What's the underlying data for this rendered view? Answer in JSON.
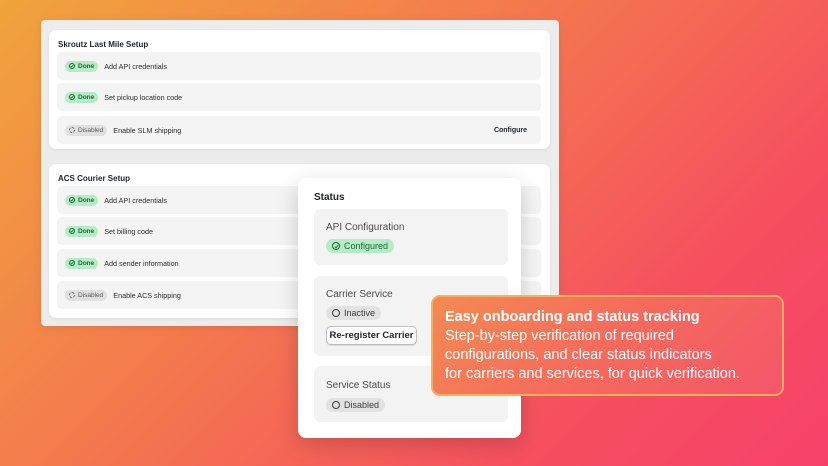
{
  "skroutz": {
    "title": "Skroutz Last Mile Setup",
    "rows": [
      {
        "badge": "Done",
        "label": "Add API credentials"
      },
      {
        "badge": "Done",
        "label": "Set pickup location code"
      },
      {
        "badge": "Disabled",
        "label": "Enable SLM shipping",
        "action": "Configure"
      }
    ]
  },
  "acs": {
    "title": "ACS Courier Setup",
    "rows": [
      {
        "badge": "Done",
        "label": "Add API credentials"
      },
      {
        "badge": "Done",
        "label": "Set billing code"
      },
      {
        "badge": "Done",
        "label": "Add sender information"
      },
      {
        "badge": "Disabled",
        "label": "Enable ACS shipping"
      }
    ]
  },
  "status": {
    "title": "Status",
    "api": {
      "label": "API Configuration",
      "badge": "Configured"
    },
    "carrier": {
      "label": "Carrier Service",
      "badge": "Inactive",
      "button": "Re-register Carrier"
    },
    "service": {
      "label": "Service Status",
      "badge": "Disabled"
    }
  },
  "callout": {
    "title": "Easy onboarding and status tracking",
    "lines": [
      "Step-by-step verification of required",
      "configurations, and clear status indicators",
      "for carriers and services, for quick verification."
    ]
  },
  "colors": {
    "done_bg": "#b7ebc5",
    "done_text": "#176a37",
    "disabled_bg": "#e0e0e0",
    "callout_border": "#f7b05b"
  }
}
